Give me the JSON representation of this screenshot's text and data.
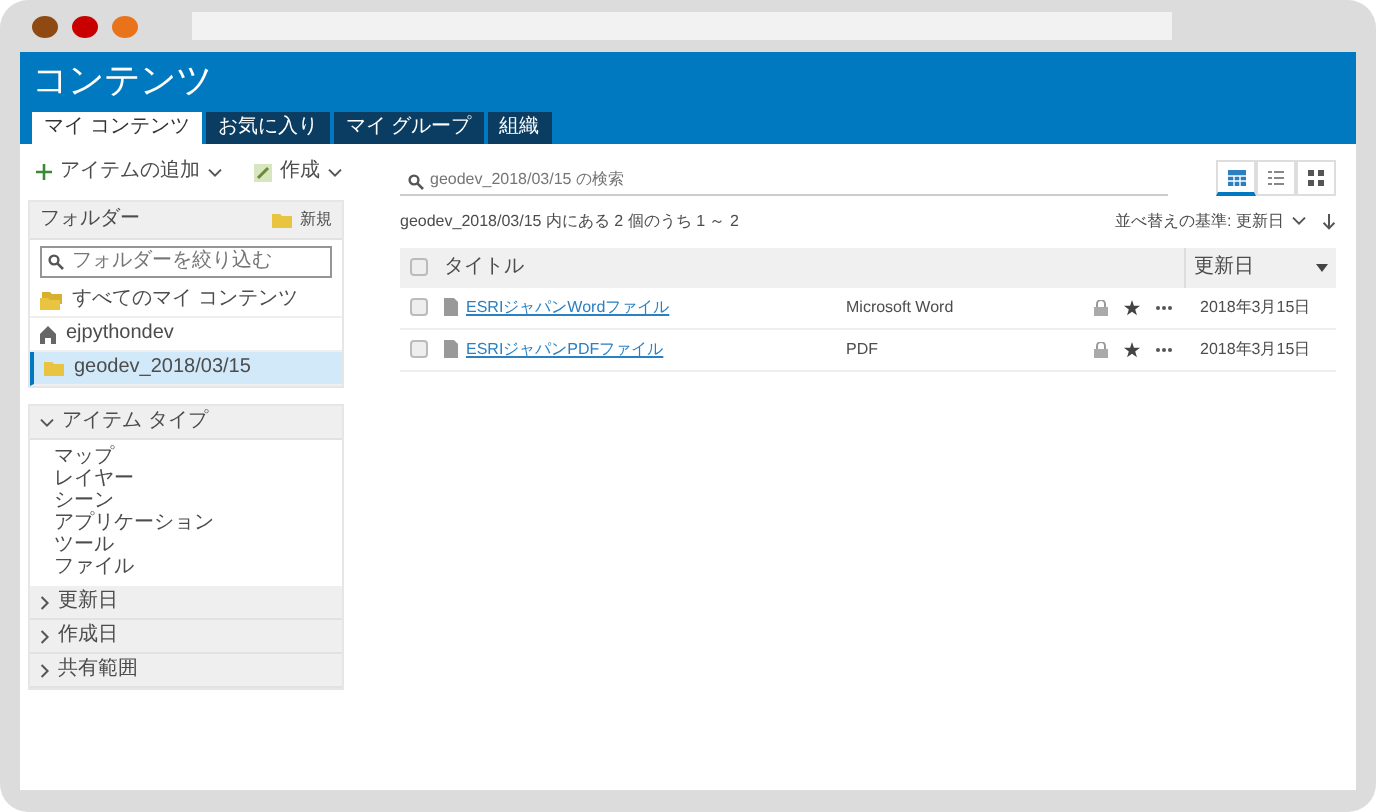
{
  "banner": {
    "title": "コンテンツ"
  },
  "tabs": [
    {
      "label": "マイ コンテンツ",
      "selected": true
    },
    {
      "label": "お気に入り",
      "selected": false
    },
    {
      "label": "マイ グループ",
      "selected": false
    },
    {
      "label": "組織",
      "selected": false
    }
  ],
  "toolbar": {
    "add_item": "アイテムの追加",
    "create": "作成"
  },
  "folders": {
    "header": "フォルダー",
    "new": "新規",
    "filter": {
      "placeholder": "フォルダーを絞り込む"
    },
    "items": [
      {
        "label": "すべてのマイ コンテンツ",
        "kind": "all",
        "selected": false
      },
      {
        "label": "ejpythondev",
        "kind": "user",
        "selected": false
      },
      {
        "label": "geodev_2018/03/15",
        "kind": "folder",
        "selected": true
      }
    ]
  },
  "filter_sections": [
    {
      "label": "アイテム タイプ",
      "expanded": true,
      "items": [
        "マップ",
        "レイヤー",
        "シーン",
        "アプリケーション",
        "ツール",
        "ファイル"
      ]
    },
    {
      "label": "更新日",
      "expanded": false
    },
    {
      "label": "作成日",
      "expanded": false
    },
    {
      "label": "共有範囲",
      "expanded": false
    }
  ],
  "search": {
    "placeholder": "geodev_2018/03/15 の検索"
  },
  "view_buttons": [
    {
      "kind": "table",
      "selected": true
    },
    {
      "kind": "list",
      "selected": false
    },
    {
      "kind": "grid",
      "selected": false
    }
  ],
  "result_count": "geodev_2018/03/15 内にある 2 個のうち 1 ～ 2",
  "sort": {
    "label": "並べ替えの基準: 更新日"
  },
  "table": {
    "select_all": {
      "checked": false
    },
    "columns": [
      "タイトル",
      "更新日"
    ],
    "rows": [
      {
        "title": "ESRIジャパンWordファイル",
        "type": "Microsoft Word",
        "modified": "2018年3月15日",
        "checked": false
      },
      {
        "title": "ESRIジャパンPDFファイル",
        "type": "PDF",
        "modified": "2018年3月15日",
        "checked": false
      }
    ]
  }
}
